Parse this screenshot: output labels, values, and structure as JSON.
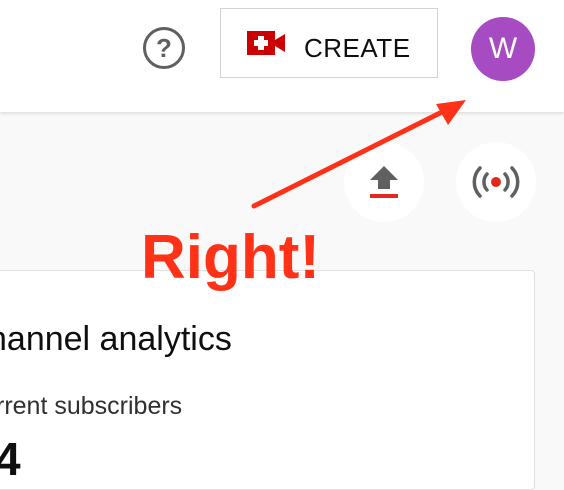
{
  "header": {
    "help_icon": "question-circle-icon",
    "help_glyph": "?",
    "create_label": "CREATE",
    "create_icon": "video-camera-plus-icon",
    "avatar_letter": "W",
    "avatar_color": "#a64bc2"
  },
  "actions": {
    "upload_icon": "upload-icon",
    "live_icon": "live-broadcast-icon"
  },
  "card": {
    "title": "hannel analytics",
    "subscribers_label": "rrent subscribers",
    "subscribers_value": "4"
  },
  "annotation": {
    "text": "Right!",
    "color": "#ff3217"
  }
}
